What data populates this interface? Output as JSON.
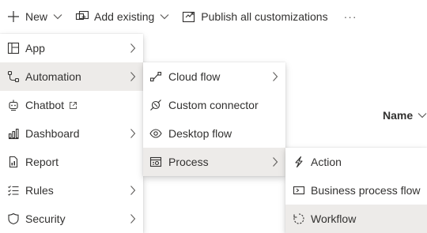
{
  "toolbar": {
    "new_label": "New",
    "add_existing_label": "Add existing",
    "publish_label": "Publish all customizations",
    "more_label": "···"
  },
  "background": {
    "column_header": "Name"
  },
  "new_menu": {
    "items": [
      {
        "label": "App",
        "icon": "app-icon",
        "submenu": true
      },
      {
        "label": "Automation",
        "icon": "automation-icon",
        "submenu": true,
        "active": true
      },
      {
        "label": "Chatbot",
        "icon": "chatbot-icon",
        "external": true
      },
      {
        "label": "Dashboard",
        "icon": "dashboard-icon",
        "submenu": true
      },
      {
        "label": "Report",
        "icon": "report-icon"
      },
      {
        "label": "Rules",
        "icon": "rules-icon",
        "submenu": true
      },
      {
        "label": "Security",
        "icon": "security-icon",
        "submenu": true
      }
    ]
  },
  "automation_menu": {
    "items": [
      {
        "label": "Cloud flow",
        "icon": "cloud-flow-icon",
        "submenu": true
      },
      {
        "label": "Custom connector",
        "icon": "custom-connector-icon"
      },
      {
        "label": "Desktop flow",
        "icon": "desktop-flow-icon"
      },
      {
        "label": "Process",
        "icon": "process-icon",
        "submenu": true,
        "active": true
      }
    ]
  },
  "process_menu": {
    "items": [
      {
        "label": "Action",
        "icon": "action-icon"
      },
      {
        "label": "Business process flow",
        "icon": "business-process-flow-icon"
      },
      {
        "label": "Workflow",
        "icon": "workflow-icon",
        "active": true
      }
    ]
  }
}
